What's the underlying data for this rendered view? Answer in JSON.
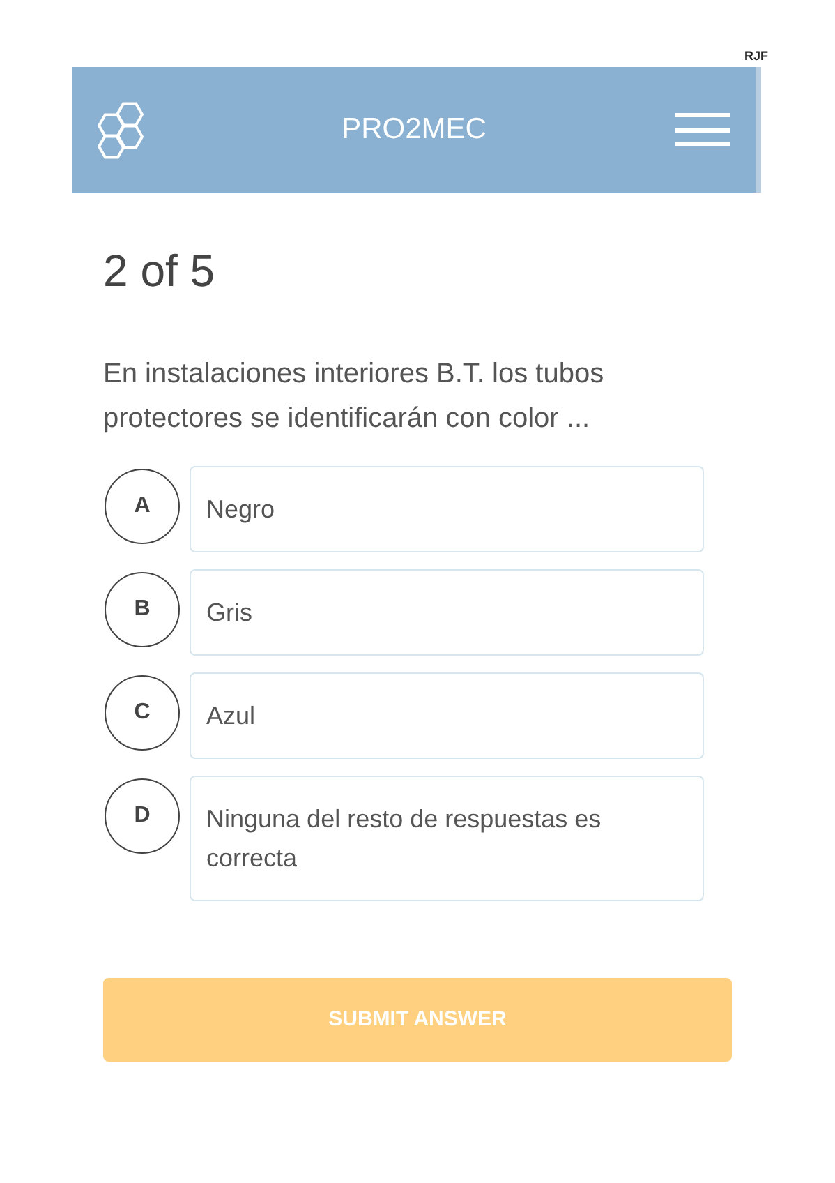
{
  "corner_note": "RJF",
  "header": {
    "title": "PRO2MEC"
  },
  "progress": "2 of 5",
  "question": "En instalaciones interiores B.T. los tubos protectores se identificarán con color ...",
  "options": [
    {
      "letter": "A",
      "text": "Negro",
      "selected": false
    },
    {
      "letter": "B",
      "text": "Gris",
      "selected": false
    },
    {
      "letter": "C",
      "text": "Azul",
      "selected": false
    },
    {
      "letter": "D",
      "text": "Ninguna del resto de respuestas es correcta",
      "selected": false
    }
  ],
  "submit": {
    "label": "SUBMIT ANSWER",
    "disabled": true
  }
}
